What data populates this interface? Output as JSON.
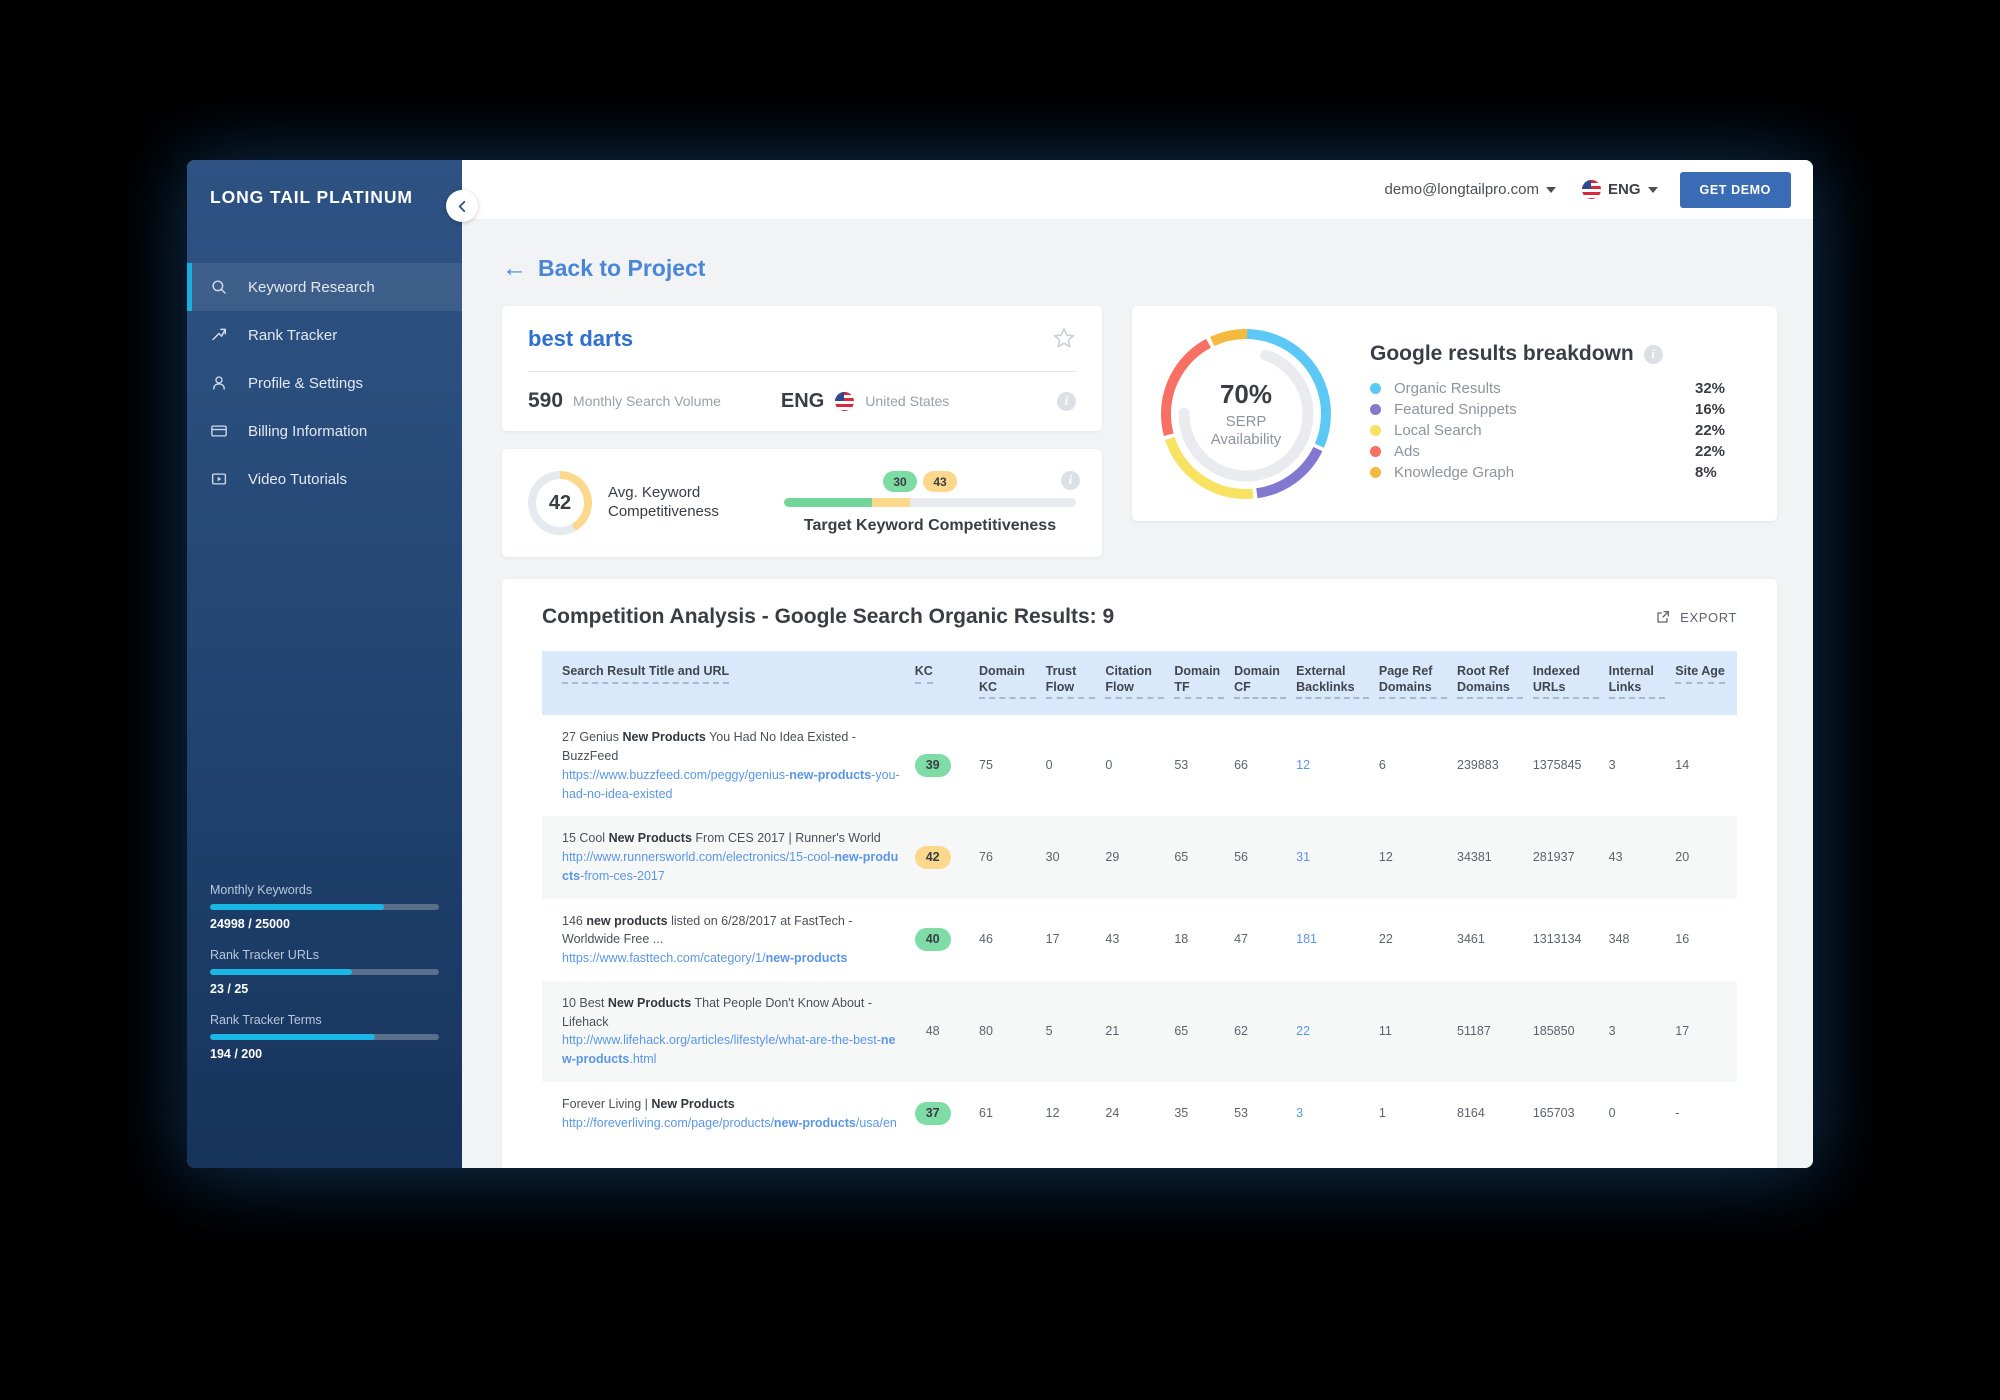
{
  "sidebar": {
    "brand": "LONG TAIL PLATINUM",
    "collapse_icon": "chevron-left-icon",
    "items": [
      {
        "label": "Keyword Research",
        "icon": "search-icon",
        "active": true
      },
      {
        "label": "Rank Tracker",
        "icon": "trend-up-icon",
        "active": false
      },
      {
        "label": "Profile & Settings",
        "icon": "user-icon",
        "active": false
      },
      {
        "label": "Billing Information",
        "icon": "credit-card-icon",
        "active": false
      },
      {
        "label": "Video Tutorials",
        "icon": "play-box-icon",
        "active": false
      }
    ],
    "stats": [
      {
        "label": "Monthly Keywords",
        "value": "24998 / 25000",
        "percent": 76
      },
      {
        "label": "Rank Tracker URLs",
        "value": "23 / 25",
        "percent": 62
      },
      {
        "label": "Rank Tracker Terms",
        "value": "194 / 200",
        "percent": 72
      }
    ],
    "accent": "#19b8e4"
  },
  "topbar": {
    "account_email": "demo@longtailpro.com",
    "language": "ENG",
    "flag_icon": "us-flag-icon",
    "demo_button": "GET DEMO",
    "demo_button_color": "#3a6bb5"
  },
  "back_link": {
    "label": "Back to Project",
    "arrow": "arrow-left-icon"
  },
  "keyword_card": {
    "keyword": "best darts",
    "favorite_icon": "star-outline-icon",
    "search_volume": "590",
    "search_volume_label": "Monthly Search Volume",
    "language": "ENG",
    "country": "United States",
    "info_icon": "info-icon"
  },
  "competitiveness_card": {
    "gauge_value": "42",
    "gauge_label": "Avg. Keyword Competitiveness",
    "gauge_percent": 42,
    "gauge_color": "#fbd88c",
    "target_caption": "Target Keyword Competitiveness",
    "markers": [
      {
        "value": "30",
        "color": "green"
      },
      {
        "value": "43",
        "color": "yellow"
      }
    ],
    "green_end": 30,
    "yellow_end": 43,
    "info_icon": "info-icon"
  },
  "google_breakdown": {
    "title": "Google results breakdown",
    "info_icon": "info-icon",
    "center_value": "70%",
    "center_label_line1": "SERP",
    "center_label_line2": "Availability"
  },
  "chart_data": {
    "type": "pie",
    "title": "Google results breakdown",
    "categories": [
      "Organic Results",
      "Featured Snippets",
      "Local Search",
      "Ads",
      "Knowledge Graph"
    ],
    "values": [
      32,
      16,
      22,
      22,
      8
    ],
    "value_labels": [
      "32%",
      "16%",
      "22%",
      "22%",
      "8%"
    ],
    "colors": [
      "#5bc8f5",
      "#8278cf",
      "#f7e261",
      "#f86f63",
      "#f6b93f"
    ],
    "legend_position": "right",
    "annotations": {
      "center_value": "70%",
      "center_label": "SERP Availability",
      "inner_arc_percent": 70,
      "inner_arc_color": "#e9ebee"
    }
  },
  "table_section": {
    "title": "Competition Analysis - Google Search Organic Results: 9",
    "export_label": "EXPORT",
    "export_icon": "external-link-icon",
    "columns": [
      "Search Result Title and URL",
      "KC",
      "Domain KC",
      "Trust Flow",
      "Citation Flow",
      "Domain TF",
      "Domain CF",
      "External Backlinks",
      "Page Ref Domains",
      "Root Ref Domains",
      "Indexed URLs",
      "Internal Links",
      "Site Age"
    ],
    "rows": [
      {
        "title_pre": "27 Genius ",
        "title_bold": "New Products",
        "title_post": " You Had No Idea Existed - BuzzFeed",
        "url_pre": "https://www.buzzfeed.com/peggy/genius-",
        "url_bold": "new-products",
        "url_post": "-you-had-no-idea-existed",
        "kc": "39",
        "kc_style": "green",
        "domain_kc": "75",
        "trust_flow": "0",
        "citation_flow": "0",
        "domain_tf": "53",
        "domain_cf": "66",
        "external_backlinks": "12",
        "page_ref_domains": "6",
        "root_ref_domains": "239883",
        "indexed_urls": "1375845",
        "internal_links": "3",
        "site_age": "14"
      },
      {
        "title_pre": "15 Cool ",
        "title_bold": "New Products",
        "title_post": " From CES 2017 | Runner's World",
        "url_pre": "http://www.runnersworld.com/electronics/15-cool-",
        "url_bold": "new-products",
        "url_post": "-from-ces-2017",
        "kc": "42",
        "kc_style": "yellow",
        "domain_kc": "76",
        "trust_flow": "30",
        "citation_flow": "29",
        "domain_tf": "65",
        "domain_cf": "56",
        "external_backlinks": "31",
        "page_ref_domains": "12",
        "root_ref_domains": "34381",
        "indexed_urls": "281937",
        "internal_links": "43",
        "site_age": "20"
      },
      {
        "title_pre": "146 ",
        "title_bold": "new products",
        "title_post": " listed on 6/28/2017 at FastTech - Worldwide Free ...",
        "url_pre": "https://www.fasttech.com/category/1/",
        "url_bold": "new-products",
        "url_post": "",
        "kc": "40",
        "kc_style": "green",
        "domain_kc": "46",
        "trust_flow": "17",
        "citation_flow": "43",
        "domain_tf": "18",
        "domain_cf": "47",
        "external_backlinks": "181",
        "page_ref_domains": "22",
        "root_ref_domains": "3461",
        "indexed_urls": "1313134",
        "internal_links": "348",
        "site_age": "16"
      },
      {
        "title_pre": "10 Best ",
        "title_bold": "New Products",
        "title_post": " That People Don't Know About - Lifehack",
        "url_pre": "http://www.lifehack.org/articles/lifestyle/what-are-the-best-",
        "url_bold": "new-products",
        "url_post": ".html",
        "kc": "48",
        "kc_style": "none",
        "domain_kc": "80",
        "trust_flow": "5",
        "citation_flow": "21",
        "domain_tf": "65",
        "domain_cf": "62",
        "external_backlinks": "22",
        "page_ref_domains": "11",
        "root_ref_domains": "51187",
        "indexed_urls": "185850",
        "internal_links": "3",
        "site_age": "17"
      },
      {
        "title_pre": "Forever Living | ",
        "title_bold": "New Products",
        "title_post": "",
        "url_pre": "http://foreverliving.com/page/products/",
        "url_bold": "new-products",
        "url_post": "/usa/en",
        "kc": "37",
        "kc_style": "green",
        "domain_kc": "61",
        "trust_flow": "12",
        "citation_flow": "24",
        "domain_tf": "35",
        "domain_cf": "53",
        "external_backlinks": "3",
        "page_ref_domains": "1",
        "root_ref_domains": "8164",
        "indexed_urls": "165703",
        "internal_links": "0",
        "site_age": "-"
      }
    ]
  }
}
